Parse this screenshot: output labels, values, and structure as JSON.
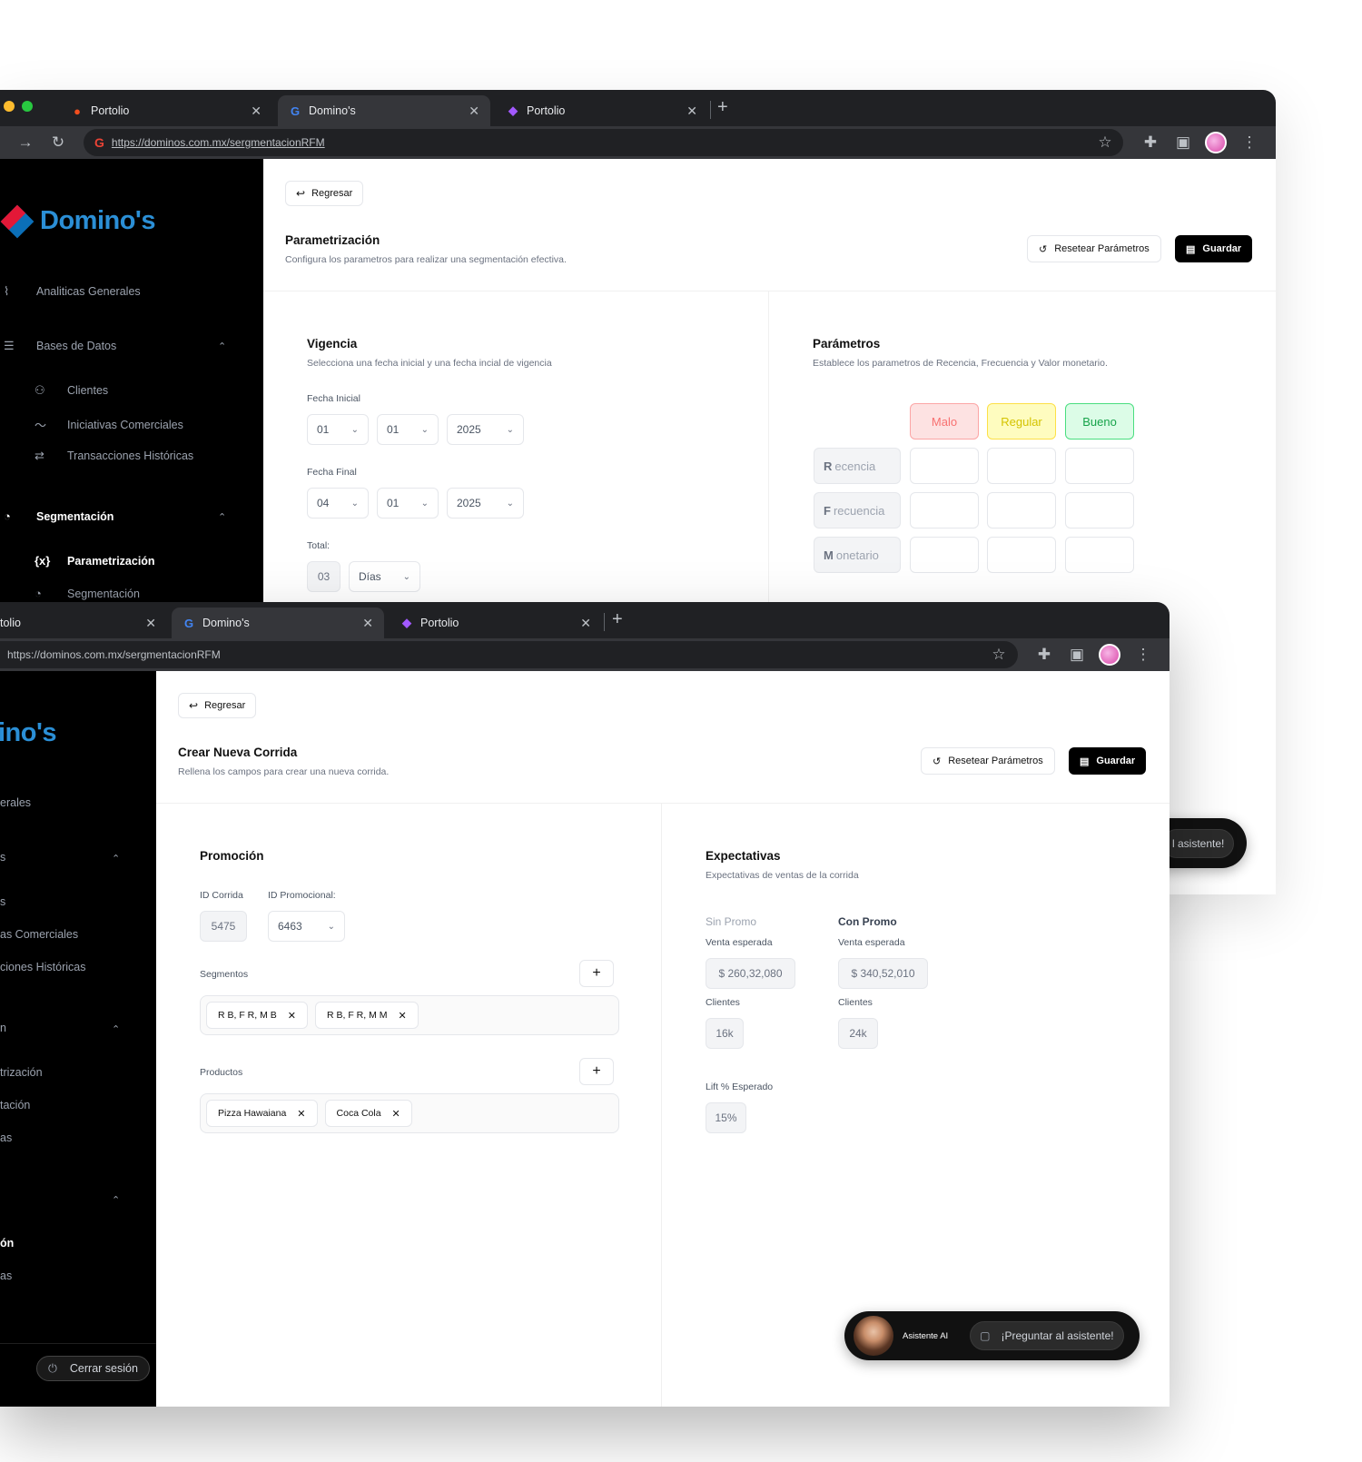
{
  "browser": {
    "tabs": [
      {
        "label": "Portolio",
        "favicon": "figma-icon"
      },
      {
        "label": "Domino's",
        "favicon": "google-icon"
      },
      {
        "label": "Portolio",
        "favicon": "figma-icon"
      }
    ],
    "url": "https://dominos.com.mx/sergmentacionRFM"
  },
  "sidebar": {
    "logo": "Domino's",
    "items": {
      "analytics": "Analiticas Generales",
      "databases": "Bases de Datos",
      "clients": "Clientes",
      "initiatives": "Iniciativas Comerciales",
      "transactions": "Transacciones Históricas",
      "segmentation": "Segmentación",
      "param": "Parametrización",
      "segment": "Segmentación"
    },
    "cropped": {
      "logo": "ino's",
      "analytics": "erales",
      "databases": "s",
      "clients": "s",
      "initiatives": "as Comerciales",
      "transactions": "ciones Históricas",
      "seg_group": "n",
      "param": "trización",
      "segment": "tación",
      "extra": "as",
      "strong": "ón",
      "extra2": "as"
    },
    "logout": "Cerrar sesión"
  },
  "common": {
    "back": "Regresar",
    "reset": "Resetear Parámetros",
    "save": "Guardar"
  },
  "param_page": {
    "title": "Parametrización",
    "desc": "Configura los parametros para realizar una segmentación efectiva.",
    "vigencia": {
      "title": "Vigencia",
      "desc": "Selecciona una fecha inicial y una fecha incial de vigencia",
      "fecha_inicial_label": "Fecha Inicial",
      "fecha_inicial": [
        "01",
        "01",
        "2025"
      ],
      "fecha_final_label": "Fecha Final",
      "fecha_final": [
        "04",
        "01",
        "2025"
      ],
      "total_label": "Total:",
      "total_value": "03",
      "total_unit": "Días"
    },
    "parametros": {
      "title": "Parámetros",
      "desc": "Establece los parametros de Recencia, Frecuencia y Valor monetario.",
      "headers": [
        "Malo",
        "Regular",
        "Bueno"
      ],
      "header_colors": {
        "malo_bg": "#fde2e2",
        "malo_fg": "#f87171",
        "regular_bg": "#fefcbf",
        "regular_fg": "#d4c300",
        "bueno_bg": "#dcfce7",
        "bueno_fg": "#16a34a"
      },
      "rows": [
        {
          "initial": "R",
          "rest": "ecencia"
        },
        {
          "initial": "F",
          "rest": "recuencia"
        },
        {
          "initial": "M",
          "rest": "onetario"
        }
      ]
    }
  },
  "run_page": {
    "title": "Crear Nueva Corrida",
    "desc": "Rellena los campos para crear una nueva corrida.",
    "promocion": {
      "title": "Promoción",
      "id_corrida_label": "ID Corrida",
      "id_corrida": "5475",
      "id_promo_label": "ID Promocional:",
      "id_promo": "6463",
      "segmentos_label": "Segmentos",
      "segmentos": [
        "R B, F R, M B",
        "R B, F R, M M"
      ],
      "productos_label": "Productos",
      "productos": [
        "Pizza Hawaiana",
        "Coca Cola"
      ]
    },
    "expectativas": {
      "title": "Expectativas",
      "desc": "Expectativas de ventas de la corrida",
      "sin_promo": "Sin Promo",
      "con_promo": "Con Promo",
      "venta_label": "Venta esperada",
      "venta_sin": "$ 260,32,080",
      "venta_con": "$ 340,52,010",
      "clientes_label": "Clientes",
      "clientes_sin": "16k",
      "clientes_con": "24k",
      "lift_label": "Lift % Esperado",
      "lift": "15%"
    }
  },
  "assistant": {
    "name": "Asistente AI",
    "ask": "¡Preguntar al asistente!",
    "ask_cropped": "l asistente!"
  }
}
